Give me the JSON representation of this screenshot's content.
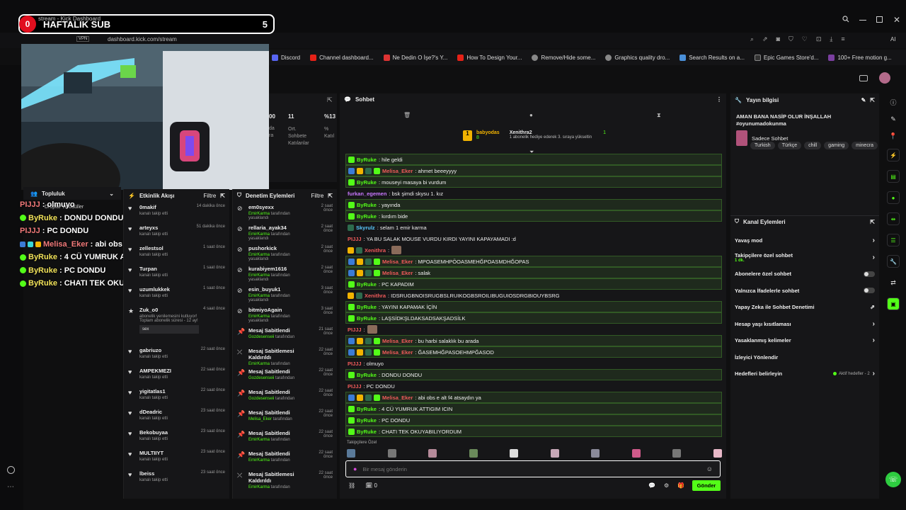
{
  "browser": {
    "tab_title": "stream - Kick Dashboard",
    "url": "dashboard.kick.com/stream",
    "vpn_label": "VPN",
    "bookmarks": [
      "Discord",
      "Channel dashboard...",
      "Ne Dedin O İşe?'s Y...",
      "How To Design Your...",
      "Remove/Hide some...",
      "Graphics quality dro...",
      "Search Results on a...",
      "Epic Games Store'd...",
      "100+ Free motion g..."
    ],
    "ai_label": "AI"
  },
  "banner": {
    "badge": "0",
    "title": "HAFTALIK SUB",
    "count": "5"
  },
  "overlay_chat": [
    {
      "user": "PIJJJ",
      "text": " : olmuyo",
      "color": "#f27a7a",
      "badge": false,
      "icons": false
    },
    {
      "user": "ByRuke",
      "text": " : DONDU DONDU",
      "color": "#f2e35a",
      "badge": true,
      "icons": false
    },
    {
      "user": "PIJJJ",
      "text": " : PC DONDU",
      "color": "#f27a7a",
      "badge": false,
      "icons": false
    },
    {
      "user": "Melisa_Eker",
      "text": " : abi obs e alt f4 atsaydin ya",
      "color": "#f27a7a",
      "badge": false,
      "icons": true
    },
    {
      "user": "ByRuke",
      "text": " : 4 CÜ YUMRUK ATTIGIM ICIN",
      "color": "#f2e35a",
      "badge": true,
      "icons": false
    },
    {
      "user": "ByRuke",
      "text": " : PC DONDU",
      "color": "#f2e35a",
      "badge": true,
      "icons": false
    },
    {
      "user": "ByRuke",
      "text": " : CHATI TEK OKUYABILIYORDUM",
      "color": "#f2e35a",
      "badge": true,
      "icons": false
    }
  ],
  "community": {
    "title": "Topluluk",
    "drops_label": "Droplar ve ödüller"
  },
  "stats": {
    "label_ort": "Ort.",
    "label_sohbete": "Sohbete",
    "label_katilanlar": "Katılanlar",
    "label_percent": "%",
    "label_kati": "Katıl",
    "v1": "00",
    "v2": "11",
    "v3": "%13",
    "label_da": "da",
    "label_ra": "ra"
  },
  "activity": {
    "title": "Etkinlik Akışı",
    "filter": "Filtre",
    "items": [
      {
        "name": "0makif",
        "sub": "kanalı takip etti",
        "time": "14 dakika önce",
        "icon": "heart"
      },
      {
        "name": "arteyxs",
        "sub": "kanalı takip etti",
        "time": "51 dakika önce",
        "icon": "heart"
      },
      {
        "name": "zellestsol",
        "sub": "kanalı takip etti",
        "time": "1 saat önce",
        "icon": "heart"
      },
      {
        "name": "Turpan",
        "sub": "kanalı takip etti",
        "time": "1 saat önce",
        "icon": "heart"
      },
      {
        "name": "uzumlukkek",
        "sub": "kanalı takip etti",
        "time": "1 saat önce",
        "icon": "heart"
      },
      {
        "name": "Zuk_o0",
        "sub": "abonelik yenilemesini kutluyor! Toplam abonelik süresi - 12 ay!",
        "time": "4 saat önce",
        "icon": "star",
        "note": "sex"
      },
      {
        "name": "gabriuzo",
        "sub": "kanalı takip etti",
        "time": "22 saat önce",
        "icon": "heart"
      },
      {
        "name": "AMPEKMEZI",
        "sub": "kanalı takip etti",
        "time": "22 saat önce",
        "icon": "heart"
      },
      {
        "name": "yigitatlas1",
        "sub": "kanalı takip etti",
        "time": "22 saat önce",
        "icon": "heart"
      },
      {
        "name": "dDeadric",
        "sub": "kanalı takip etti",
        "time": "23 saat önce",
        "icon": "heart"
      },
      {
        "name": "Bekobuyaa",
        "sub": "kanalı takip etti",
        "time": "23 saat önce",
        "icon": "heart"
      },
      {
        "name": "MULTIIYT",
        "sub": "kanalı takip etti",
        "time": "23 saat önce",
        "icon": "heart"
      },
      {
        "name": "lbeiss",
        "sub": "kanalı takip etti",
        "time": "23 saat önce",
        "icon": "heart"
      }
    ]
  },
  "moderation": {
    "title": "Denetim Eylemleri",
    "filter": "Filtre",
    "items": [
      {
        "name": "em0syexx",
        "by": "EmirKarma",
        "suffix": " tarafından yasaklandı",
        "time": "2 saat önce",
        "icon": "ban"
      },
      {
        "name": "rellaria_ayak34",
        "by": "EmirKarma",
        "suffix": " tarafından yasaklandı",
        "time": "2 saat önce",
        "icon": "ban"
      },
      {
        "name": "pushorkick",
        "by": "EmirKarma",
        "suffix": " tarafından yasaklandı",
        "time": "2 saat önce",
        "icon": "ban"
      },
      {
        "name": "kurabiyem1616",
        "by": "EmirKarma",
        "suffix": " tarafından yasaklandı",
        "time": "2 saat önce",
        "icon": "ban"
      },
      {
        "name": "esin_buyuk1",
        "by": "EmirKarma",
        "suffix": " tarafından yasaklandı",
        "time": "3 saat önce",
        "icon": "ban"
      },
      {
        "name": "bitmiyoAgain",
        "by": "EmirKarma",
        "suffix": " tarafından yasaklandı",
        "time": "3 saat önce",
        "icon": "ban"
      },
      {
        "name": "Mesaj Sabitlendi",
        "by": "Gozdesenseii",
        "suffix": " tarafından",
        "time": "21 saat önce",
        "icon": "pin"
      },
      {
        "name": "Mesaj Sabitlemesi Kaldırıldı",
        "by": "EmirKarma",
        "suffix": " tarafından",
        "time": "22 saat önce",
        "icon": "unpin"
      },
      {
        "name": "Mesaj Sabitlendi",
        "by": "Gozdesenseii",
        "suffix": " tarafından",
        "time": "22 saat önce",
        "icon": "pin"
      },
      {
        "name": "Mesaj Sabitlendi",
        "by": "Gozdesenseii",
        "suffix": " tarafından",
        "time": "22 saat önce",
        "icon": "pin"
      },
      {
        "name": "Mesaj Sabitlendi",
        "by": "Melisa_Eker",
        "suffix": " tarafından",
        "time": "22 saat önce",
        "icon": "pin"
      },
      {
        "name": "Mesaj Sabitlendi",
        "by": "EmirKarma",
        "suffix": " tarafından",
        "time": "22 saat önce",
        "icon": "pin"
      },
      {
        "name": "Mesaj Sabitlendi",
        "by": "EmirKarma",
        "suffix": " tarafından",
        "time": "22 saat önce",
        "icon": "pin"
      },
      {
        "name": "Mesaj Sabitlemesi Kaldırıldı",
        "by": "EmirKarma",
        "suffix": " tarafından",
        "time": "22 saat önce",
        "icon": "unpin"
      }
    ]
  },
  "chat": {
    "title": "Sohbet",
    "leader1": {
      "name": "babyodas",
      "count": "8"
    },
    "leader2": {
      "name": "Xenithra2",
      "count": "1",
      "desc": "1 abonelik hediye ederek 3. sıraya yükseltin"
    },
    "messages": [
      {
        "user": "ByRuke",
        "text": ": hile geldi",
        "color": "#53fc18",
        "hl": true,
        "badges": [
          "#53fc18"
        ]
      },
      {
        "user": "Melisa_Eker",
        "text": ": ahmet beeeyyyy",
        "color": "#f05a5a",
        "hl": true,
        "badges": [
          "#3b7bd6",
          "#f2b300",
          "#2d6b4d",
          "#53fc18"
        ]
      },
      {
        "user": "ByRuke",
        "text": ": mouseyi masaya bi vurdum",
        "color": "#53fc18",
        "hl": true,
        "badges": [
          "#53fc18"
        ]
      },
      {
        "user": "furkan_egemen",
        "text": ": bsk şimdi skysu 1. kız",
        "color": "#c978ff",
        "hl": false,
        "badges": []
      },
      {
        "user": "ByRuke",
        "text": ": yayında",
        "color": "#53fc18",
        "hl": true,
        "badges": [
          "#53fc18"
        ]
      },
      {
        "user": "ByRuke",
        "text": ": kırdım bide",
        "color": "#53fc18",
        "hl": true,
        "badges": [
          "#53fc18"
        ]
      },
      {
        "user": "Skyrulz",
        "text": ": selam 1 emir karma",
        "color": "#5acbff",
        "hl": false,
        "badges": [
          "#2d6b4d"
        ]
      },
      {
        "user": "PIJJJ",
        "text": ": YA BU SALAK MOUSE VURDU KIRDI YAYINI KAPAYAMADI :d",
        "color": "#f05a5a",
        "hl": false,
        "badges": []
      },
      {
        "user": "Xenithra",
        "text": ":",
        "color": "#f05a5a",
        "hl": false,
        "badges": [
          "#f2b300",
          "#2d6b4d"
        ],
        "emote": true
      },
      {
        "user": "Melisa_Eker",
        "text": ": MPOASEMHPÖOASMEHĞPOASMDHĞOPAS",
        "color": "#f05a5a",
        "hl": true,
        "badges": [
          "#3b7bd6",
          "#f2b300",
          "#2d6b4d",
          "#53fc18"
        ]
      },
      {
        "user": "Melisa_Eker",
        "text": ": salak",
        "color": "#f05a5a",
        "hl": true,
        "badges": [
          "#3b7bd6",
          "#f2b300",
          "#2d6b4d",
          "#53fc18"
        ]
      },
      {
        "user": "ByRuke",
        "text": ": PC KAPADIM",
        "color": "#53fc18",
        "hl": true,
        "badges": [
          "#53fc18"
        ]
      },
      {
        "user": "Xenithra",
        "text": ": IDSRUGBNOISRUGBSLRUIKOGBSROILIBUGUIOSDRGBIOUYBSRG",
        "color": "#f05a5a",
        "hl": false,
        "badges": [
          "#f2b300",
          "#2d6b4d"
        ]
      },
      {
        "user": "ByRuke",
        "text": ": YAYINI KAPAMAK İÇİN",
        "color": "#53fc18",
        "hl": true,
        "badges": [
          "#53fc18"
        ]
      },
      {
        "user": "ByRuke",
        "text": ": LAŞSİDKŞLDAKSADSAKŞADSİLK",
        "color": "#53fc18",
        "hl": true,
        "badges": [
          "#53fc18"
        ]
      },
      {
        "user": "PIJJJ",
        "text": ":",
        "color": "#f05a5a",
        "hl": false,
        "badges": [],
        "emote": true
      },
      {
        "user": "Melisa_Eker",
        "text": ": bu harbi salaklık bu arada",
        "color": "#f05a5a",
        "hl": true,
        "badges": [
          "#3b7bd6",
          "#f2b300",
          "#2d6b4d",
          "#53fc18"
        ]
      },
      {
        "user": "Melisa_Eker",
        "text": ": ĞASEMHĞPASOEHMPĞASOD",
        "color": "#f05a5a",
        "hl": true,
        "badges": [
          "#3b7bd6",
          "#f2b300",
          "#2d6b4d",
          "#53fc18"
        ]
      },
      {
        "user": "PIJJJ",
        "text": ": olmuyo",
        "color": "#f05a5a",
        "hl": false,
        "badges": []
      },
      {
        "user": "ByRuke",
        "text": ": DONDU DONDU",
        "color": "#53fc18",
        "hl": true,
        "badges": [
          "#53fc18"
        ]
      },
      {
        "user": "PIJJJ",
        "text": ": PC DONDU",
        "color": "#f05a5a",
        "hl": false,
        "badges": []
      },
      {
        "user": "Melisa_Eker",
        "text": ": abi obs e alt f4 atsaydın ya",
        "color": "#f05a5a",
        "hl": true,
        "badges": [
          "#3b7bd6",
          "#f2b300",
          "#2d6b4d",
          "#53fc18"
        ]
      },
      {
        "user": "ByRuke",
        "text": ": 4 CÜ YUMRUK ATTIGIM ICIN",
        "color": "#53fc18",
        "hl": true,
        "badges": [
          "#53fc18"
        ]
      },
      {
        "user": "ByRuke",
        "text": ": PC DONDU",
        "color": "#53fc18",
        "hl": true,
        "badges": [
          "#53fc18"
        ]
      },
      {
        "user": "ByRuke",
        "text": ": CHATI TEK OKUYABILIYORDUM",
        "color": "#53fc18",
        "hl": true,
        "badges": [
          "#53fc18"
        ]
      }
    ],
    "emote_section": "Takipçilere Özel",
    "placeholder": "Bir mesaj gönderin",
    "send": "Gönder",
    "count": "0"
  },
  "right_panel": {
    "info_title": "Yayın bilgisi",
    "stream_title": "AMAN BANA NASİP OLUR İNŞALLAH #oyunumadokunma",
    "category": "Sadece Sohbet",
    "tags": [
      "Turkish",
      "Türkçe",
      "chill",
      "gaming",
      "minecra"
    ],
    "actions_title": "Kanal Eylemleri",
    "actions": [
      {
        "label": "Yavaş mod",
        "type": "chevron"
      },
      {
        "label": "Takipçilere özel sohbet",
        "sub": "1 dk.",
        "type": "chevron"
      },
      {
        "label": "Abonelere özel sohbet",
        "type": "toggle"
      },
      {
        "label": "Yalnızca İfadelerle sohbet",
        "type": "toggle"
      },
      {
        "label": "Yapay Zeka ile Sohbet Denetimi",
        "type": "external"
      },
      {
        "label": "Hesap yaşı kısıtlaması",
        "type": "chevron"
      },
      {
        "label": "Yasaklanmış kelimeler",
        "type": "chevron"
      },
      {
        "label": "İzleyici Yönlendir",
        "type": "none"
      },
      {
        "label": "Hedefleri belirleyin",
        "type": "goal",
        "extra": "Aktif hedefler - 2"
      }
    ]
  }
}
